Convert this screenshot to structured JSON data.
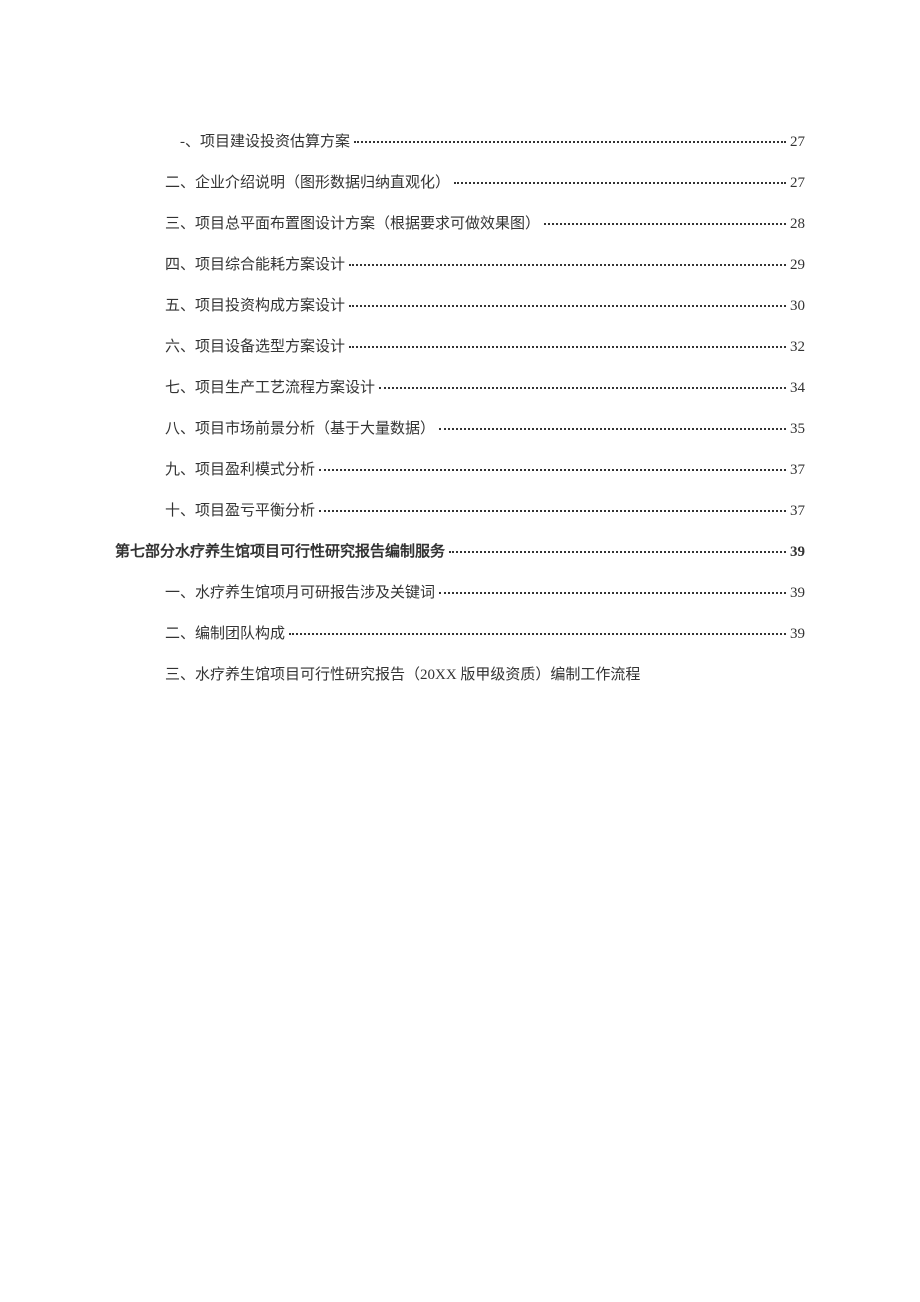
{
  "toc": {
    "entries": [
      {
        "text": "-、项目建设投资估算方案",
        "page": "27",
        "indent": 1,
        "bold": false
      },
      {
        "text": "二、企业介绍说明（图形数据归纳直观化）",
        "page": "27",
        "indent": 2,
        "bold": false
      },
      {
        "text": "三、项目总平面布置图设计方案（根据要求可做效果图）",
        "page": "28",
        "indent": 2,
        "bold": false
      },
      {
        "text": "四、项目综合能耗方案设计",
        "page": "29",
        "indent": 2,
        "bold": false
      },
      {
        "text": "五、项目投资构成方案设计",
        "page": "30",
        "indent": 2,
        "bold": false
      },
      {
        "text": "六、项目设备选型方案设计",
        "page": "32",
        "indent": 2,
        "bold": false
      },
      {
        "text": "七、项目生产工艺流程方案设计",
        "page": "34",
        "indent": 2,
        "bold": false
      },
      {
        "text": "八、项目市场前景分析（基于大量数据）",
        "page": "35",
        "indent": 2,
        "bold": false
      },
      {
        "text": "九、项目盈利模式分析",
        "page": "37",
        "indent": 2,
        "bold": false
      },
      {
        "text": "十、项目盈亏平衡分析",
        "page": "37",
        "indent": 2,
        "bold": false
      },
      {
        "text": "第七部分水疗养生馆项目可行性研究报告编制服务",
        "page": "39",
        "indent": 0,
        "bold": true
      },
      {
        "text": "一、水疗养生馆项月可研报告涉及关键词",
        "page": "39",
        "indent": 2,
        "bold": false
      },
      {
        "text": "二、编制团队构成",
        "page": "39",
        "indent": 2,
        "bold": false
      },
      {
        "text": "三、水疗养生馆项目可行性研究报告（20XX 版甲级资质）编制工作流程",
        "page": "",
        "indent": 2,
        "bold": false
      }
    ]
  }
}
